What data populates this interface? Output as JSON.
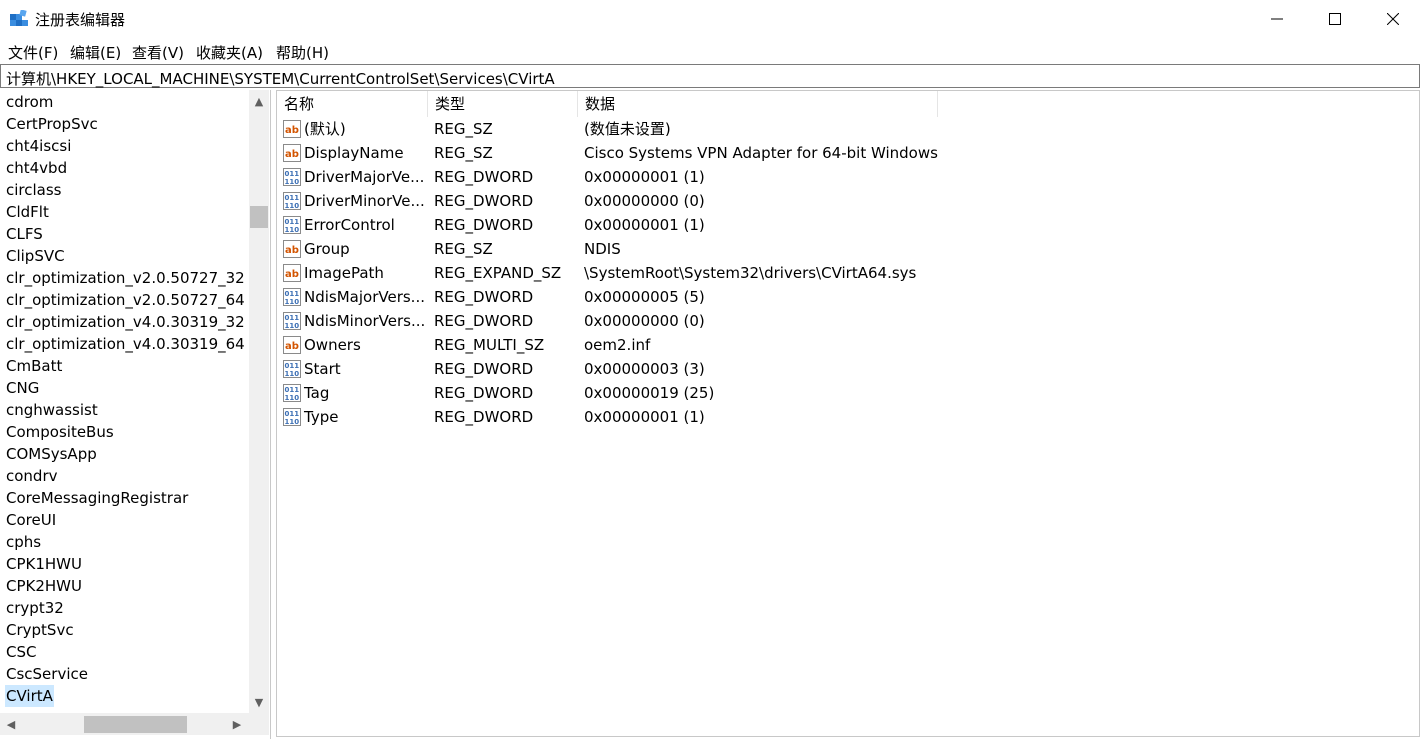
{
  "window": {
    "title": "注册表编辑器",
    "icon": "regedit-icon",
    "controls": [
      "minimize-icon",
      "maximize-icon",
      "close-icon"
    ]
  },
  "menu": [
    "文件(F)",
    "编辑(E)",
    "查看(V)",
    "收藏夹(A)",
    "帮助(H)"
  ],
  "address": "计算机\\HKEY_LOCAL_MACHINE\\SYSTEM\\CurrentControlSet\\Services\\CVirtA",
  "tree": {
    "items": [
      "cdrom",
      "CertPropSvc",
      "cht4iscsi",
      "cht4vbd",
      "circlass",
      "CldFlt",
      "CLFS",
      "ClipSVC",
      "clr_optimization_v2.0.50727_32",
      "clr_optimization_v2.0.50727_64",
      "clr_optimization_v4.0.30319_32",
      "clr_optimization_v4.0.30319_64",
      "CmBatt",
      "CNG",
      "cnghwassist",
      "CompositeBus",
      "COMSysApp",
      "condrv",
      "CoreMessagingRegistrar",
      "CoreUI",
      "cphs",
      "CPK1HWU",
      "CPK2HWU",
      "crypt32",
      "CryptSvc",
      "CSC",
      "CscService",
      "CVirtA"
    ],
    "selected": "CVirtA"
  },
  "list": {
    "columns": [
      "名称",
      "类型",
      "数据"
    ],
    "rows": [
      {
        "icon": "string-value-icon",
        "name": "(默认)",
        "type": "REG_SZ",
        "data": "(数值未设置)"
      },
      {
        "icon": "string-value-icon",
        "name": "DisplayName",
        "type": "REG_SZ",
        "data": "Cisco Systems VPN Adapter for 64-bit Windows"
      },
      {
        "icon": "binary-value-icon",
        "name": "DriverMajorVe...",
        "type": "REG_DWORD",
        "data": "0x00000001 (1)"
      },
      {
        "icon": "binary-value-icon",
        "name": "DriverMinorVe...",
        "type": "REG_DWORD",
        "data": "0x00000000 (0)"
      },
      {
        "icon": "binary-value-icon",
        "name": "ErrorControl",
        "type": "REG_DWORD",
        "data": "0x00000001 (1)"
      },
      {
        "icon": "string-value-icon",
        "name": "Group",
        "type": "REG_SZ",
        "data": "NDIS"
      },
      {
        "icon": "string-value-icon",
        "name": "ImagePath",
        "type": "REG_EXPAND_SZ",
        "data": "\\SystemRoot\\System32\\drivers\\CVirtA64.sys"
      },
      {
        "icon": "binary-value-icon",
        "name": "NdisMajorVers...",
        "type": "REG_DWORD",
        "data": "0x00000005 (5)"
      },
      {
        "icon": "binary-value-icon",
        "name": "NdisMinorVers...",
        "type": "REG_DWORD",
        "data": "0x00000000 (0)"
      },
      {
        "icon": "string-value-icon",
        "name": "Owners",
        "type": "REG_MULTI_SZ",
        "data": "oem2.inf"
      },
      {
        "icon": "binary-value-icon",
        "name": "Start",
        "type": "REG_DWORD",
        "data": "0x00000003 (3)"
      },
      {
        "icon": "binary-value-icon",
        "name": "Tag",
        "type": "REG_DWORD",
        "data": "0x00000019 (25)"
      },
      {
        "icon": "binary-value-icon",
        "name": "Type",
        "type": "REG_DWORD",
        "data": "0x00000001 (1)"
      }
    ]
  },
  "colors": {
    "selection": "#cce8ff",
    "scrollbar_track": "#f0f0f0",
    "scrollbar_thumb": "#c1c1c1",
    "string_icon": "#d35400",
    "binary_icon": "#3c6fb4"
  }
}
